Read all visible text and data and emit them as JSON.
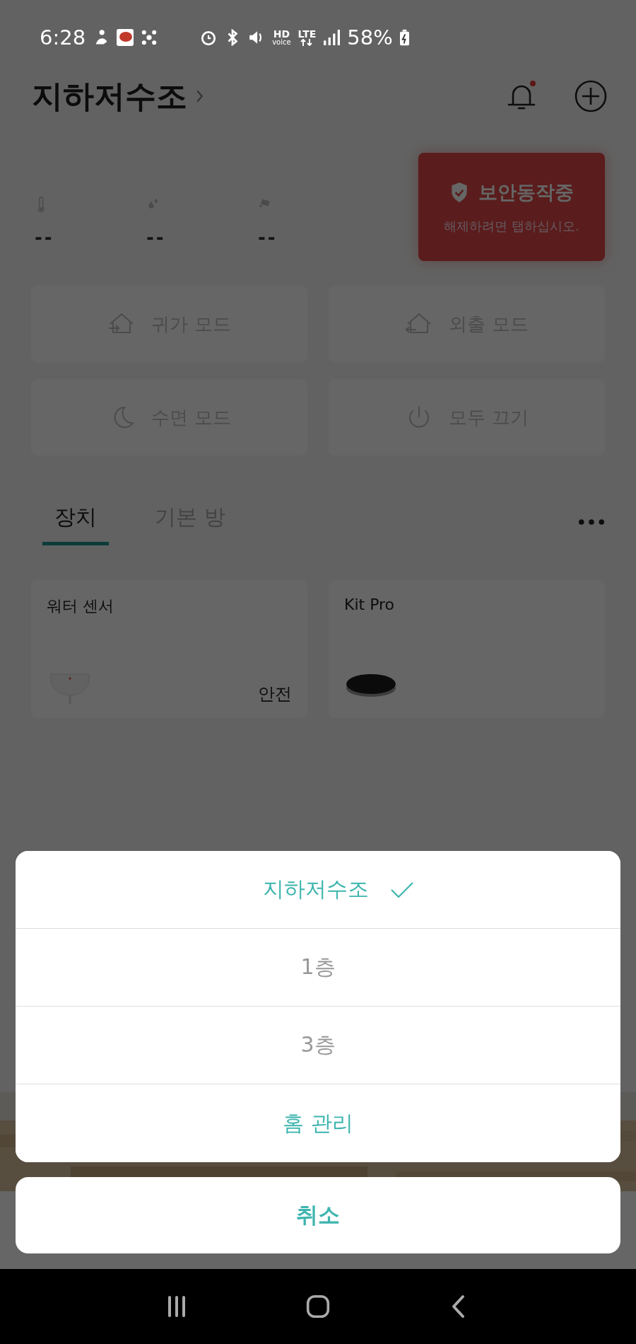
{
  "status_bar": {
    "time": "6:28",
    "hd": "HD",
    "voice": "voice",
    "network": "LTE",
    "battery": "58%"
  },
  "header": {
    "title": "지하저수조",
    "notification_dot": true
  },
  "security": {
    "title": "보안동작중",
    "subtitle": "해제하려면 탭하십시오."
  },
  "sensors": [
    {
      "kind": "temperature",
      "value": "--"
    },
    {
      "kind": "humidity",
      "value": "--"
    },
    {
      "kind": "camera",
      "value": "--"
    }
  ],
  "modes": [
    {
      "kind": "arrive",
      "label": "귀가 모드"
    },
    {
      "kind": "leave",
      "label": "외출 모드"
    },
    {
      "kind": "sleep",
      "label": "수면 모드"
    },
    {
      "kind": "power",
      "label": "모두 끄기"
    }
  ],
  "tabs": [
    {
      "label": "장치",
      "selected": true
    },
    {
      "label": "기본 방",
      "selected": false
    }
  ],
  "devices": [
    {
      "kind": "sensor",
      "name": "워터 센서",
      "status": "안전"
    },
    {
      "kind": "hub",
      "name": "Kit Pro"
    }
  ],
  "sheet": {
    "items": [
      {
        "kind": "home",
        "label": "지하저수조",
        "selected": true
      },
      {
        "kind": "home",
        "label": "1층",
        "selected": false
      },
      {
        "kind": "home",
        "label": "3층",
        "selected": false
      },
      {
        "kind": "action",
        "label": "홈 관리"
      }
    ],
    "cancel": "취소"
  }
}
